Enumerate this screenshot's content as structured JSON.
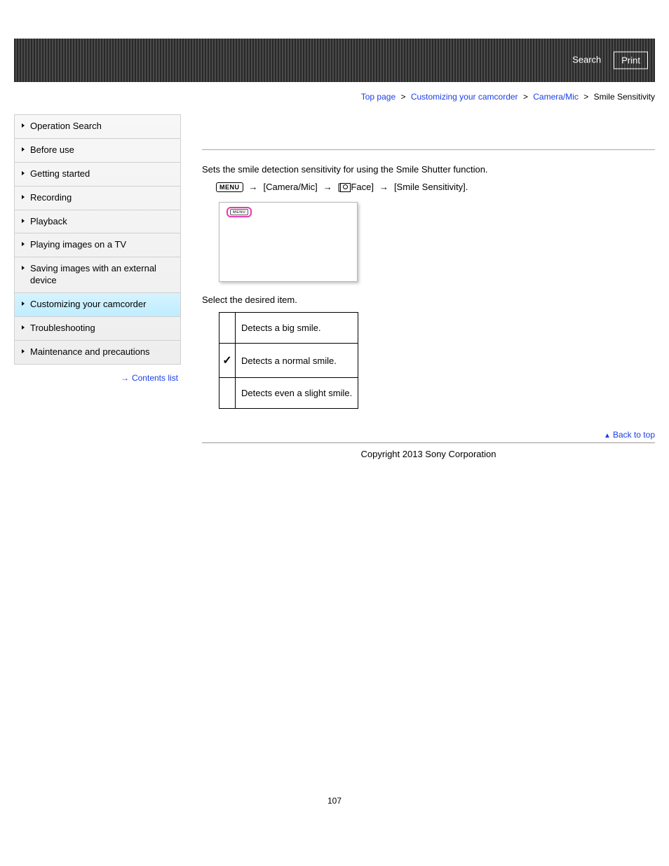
{
  "header": {
    "search_label": "Search",
    "print_label": "Print"
  },
  "breadcrumb": {
    "items": [
      "Top page",
      "Customizing your camcorder",
      "Camera/Mic"
    ],
    "current": "Smile Sensitivity",
    "sep": ">"
  },
  "sidebar": {
    "items": [
      {
        "label": "Operation Search",
        "active": false
      },
      {
        "label": "Before use",
        "active": false
      },
      {
        "label": "Getting started",
        "active": false
      },
      {
        "label": "Recording",
        "active": false
      },
      {
        "label": "Playback",
        "active": false
      },
      {
        "label": "Playing images on a TV",
        "active": false
      },
      {
        "label": "Saving images with an external device",
        "active": false
      },
      {
        "label": "Customizing your camcorder",
        "active": true
      },
      {
        "label": "Troubleshooting",
        "active": false
      },
      {
        "label": "Maintenance and precautions",
        "active": false
      }
    ],
    "contents_list_label": "Contents list"
  },
  "main": {
    "intro": "Sets the smile detection sensitivity for using the Smile Shutter function.",
    "menu_badge": "MENU",
    "path_segments": {
      "camera_mic": "[Camera/Mic]",
      "face": "Face]",
      "smile_sensitivity": "[Smile Sensitivity]."
    },
    "mock_menu_badge": "MENU",
    "select_text": "Select the desired item.",
    "options": [
      {
        "checked": false,
        "desc": "Detects a big smile."
      },
      {
        "checked": true,
        "desc": "Detects a normal smile."
      },
      {
        "checked": false,
        "desc": "Detects even a slight smile."
      }
    ],
    "back_to_top": "Back to top"
  },
  "footer": {
    "copyright": "Copyright 2013 Sony Corporation",
    "page_number": "107"
  }
}
